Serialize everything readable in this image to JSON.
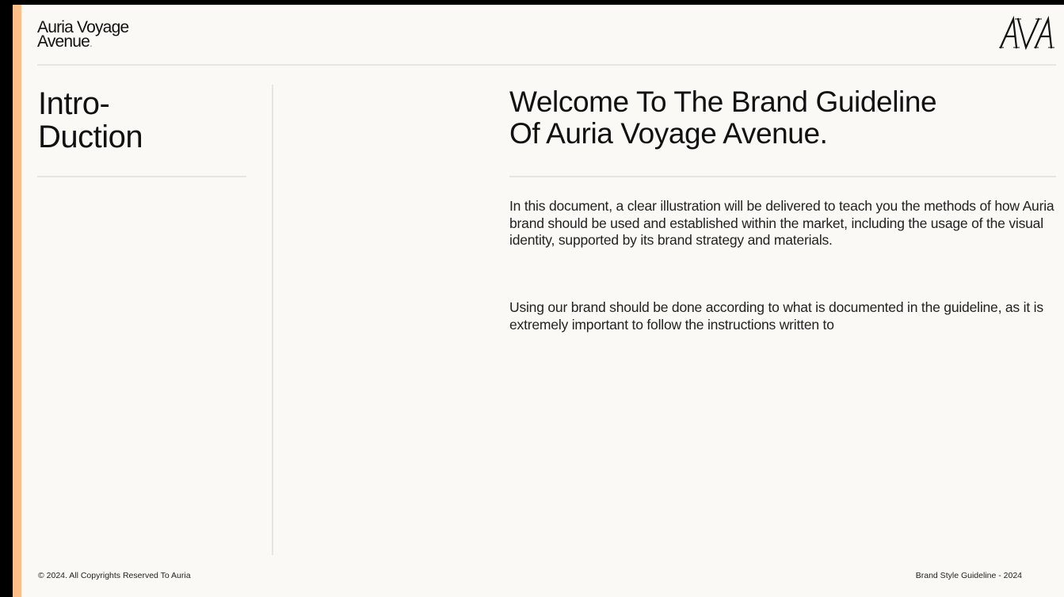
{
  "brand": {
    "line1": "Auria Voyage",
    "line2": "Avenue",
    "dot": ".",
    "monogram": "AVA"
  },
  "section": {
    "title_line1": "Intro-",
    "title_line2": "Duction"
  },
  "main": {
    "headline_line1": "Welcome To The Brand Guideline",
    "headline_line2": "Of Auria Voyage Avenue.",
    "paragraph1": "In this document, a clear illustration will be delivered to teach you the methods of how Auria brand should be used and established within the market, including the usage of the visual identity, supported by its brand strategy and materials.",
    "paragraph2": "Using our brand should be done according to what is documented in the guideline, as it is extremely important to follow the instructions written to"
  },
  "footer": {
    "copyright": "© 2024. All Copyrights Reserved To Auria",
    "doc_label": "Brand Style Guideline - 2024"
  },
  "colors": {
    "accent": "#fdbf87",
    "page_bg": "#faf9f5",
    "frame": "#000000",
    "rule": "#e6e5e1",
    "text": "#111111"
  }
}
